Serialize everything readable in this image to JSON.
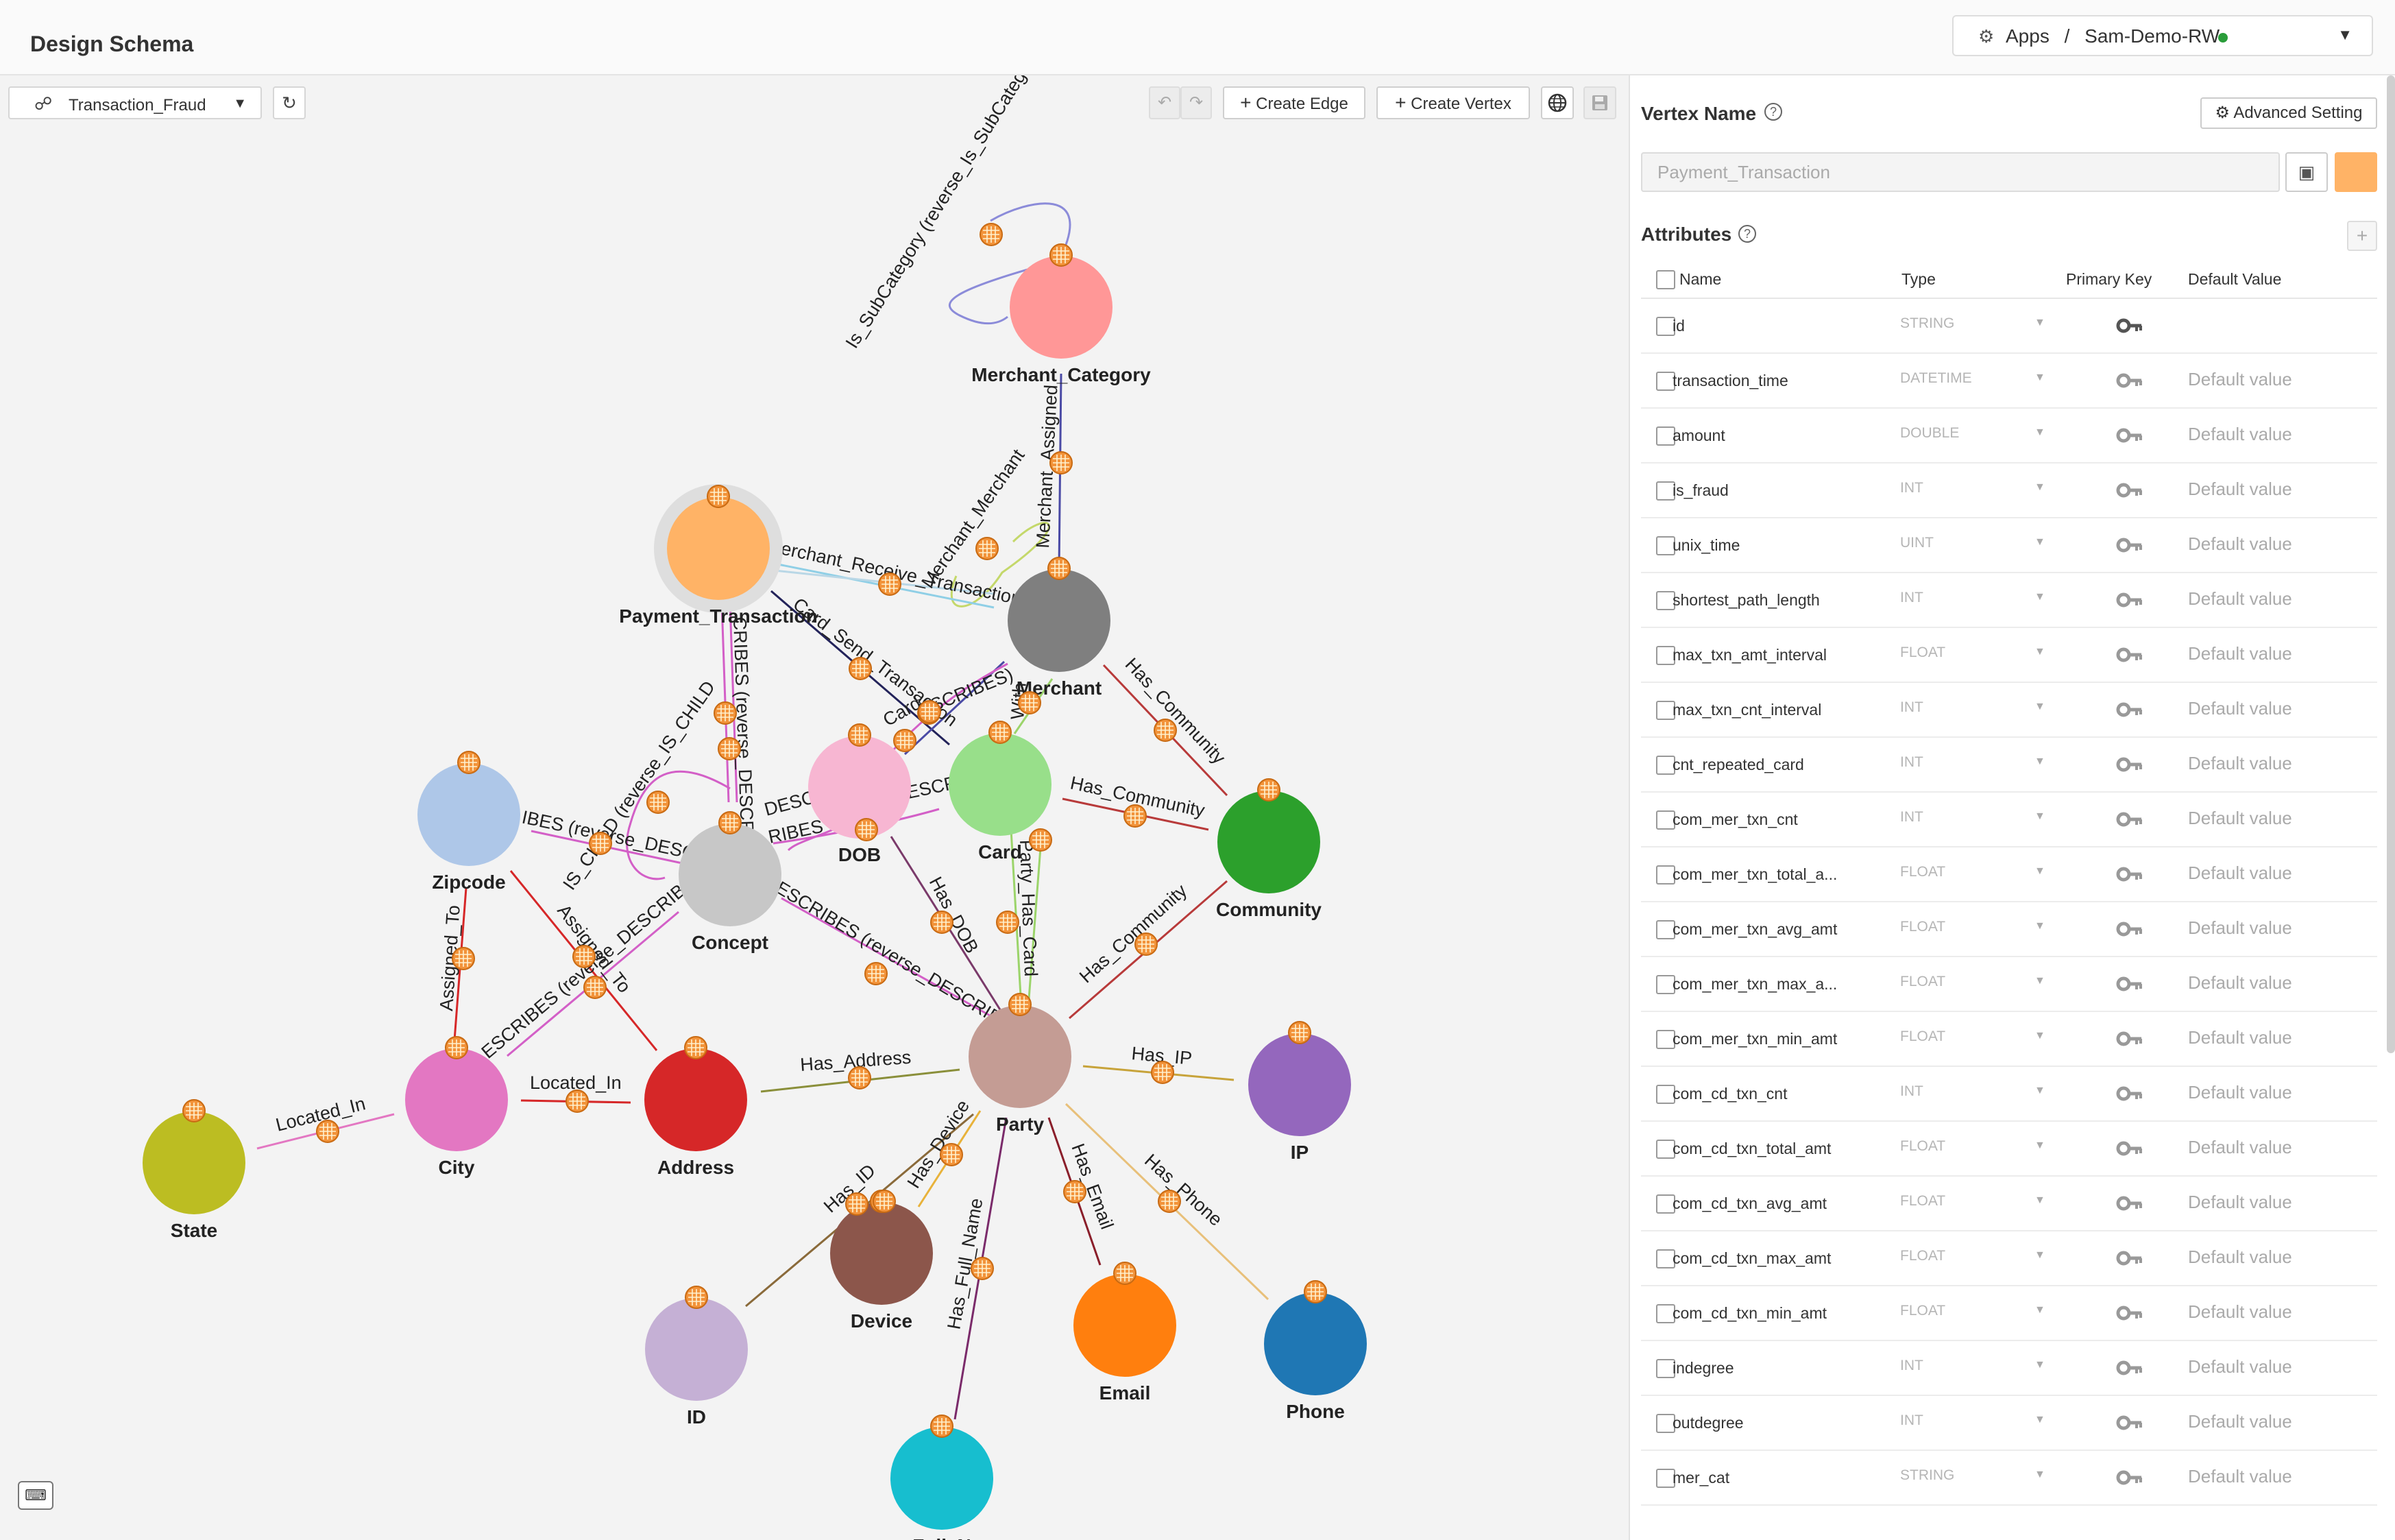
{
  "header": {
    "page_title": "Design Schema",
    "app_crumb": "Apps",
    "separator": "/",
    "workspace": "Sam-Demo-RW",
    "status_color": "#2a9d3a"
  },
  "toolbar": {
    "graph_name": "Transaction_Fraud",
    "create_edge_label": "Create Edge",
    "create_vertex_label": "Create Vertex"
  },
  "graph": {
    "vertices": [
      {
        "id": "merchant_category",
        "label": "Merchant_Category",
        "color": "#ff9797"
      },
      {
        "id": "payment_transaction",
        "label": "Payment_Transaction",
        "color": "#ffb366",
        "selected": true
      },
      {
        "id": "merchant",
        "label": "Merchant",
        "color": "#7f7f7f"
      },
      {
        "id": "zipcode",
        "label": "Zipcode",
        "color": "#aec7e8"
      },
      {
        "id": "concept",
        "label": "Concept",
        "color": "#c7c7c7"
      },
      {
        "id": "dob",
        "label": "DOB",
        "color": "#f7b6d2"
      },
      {
        "id": "card",
        "label": "Card",
        "color": "#98df8a"
      },
      {
        "id": "community",
        "label": "Community",
        "color": "#2ca02c"
      },
      {
        "id": "party",
        "label": "Party",
        "color": "#c49c94"
      },
      {
        "id": "ip",
        "label": "IP",
        "color": "#9467bd"
      },
      {
        "id": "city",
        "label": "City",
        "color": "#e377c2"
      },
      {
        "id": "address",
        "label": "Address",
        "color": "#d62728"
      },
      {
        "id": "state",
        "label": "State",
        "color": "#bcbd22"
      },
      {
        "id": "device",
        "label": "Device",
        "color": "#8c564b"
      },
      {
        "id": "id",
        "label": "ID",
        "color": "#c5b0d5"
      },
      {
        "id": "email",
        "label": "Email",
        "color": "#ff7f0e"
      },
      {
        "id": "phone",
        "label": "Phone",
        "color": "#1f77b4"
      },
      {
        "id": "full_name",
        "label": "Full_N",
        "color": "#17becf"
      }
    ],
    "edge_labels": [
      {
        "id": "is_subcategory",
        "label": "Is_SubCategory (reverse_Is_SubCategory)"
      },
      {
        "id": "merchant_assigned",
        "label": "Merchant_Assigned"
      },
      {
        "id": "merchant_merchant",
        "label": "Merchant_Merchant"
      },
      {
        "id": "merchant_receive",
        "label": "erchant_Receive_Transaction"
      },
      {
        "id": "card_send",
        "label": "Card_Send_Transaction"
      },
      {
        "id": "describes_pt",
        "label": "CRIBES (reverse_DESCRIB"
      },
      {
        "id": "has_community_merchant",
        "label": "Has_Community"
      },
      {
        "id": "has_community_card",
        "label": "Has_Community"
      },
      {
        "id": "has_community_party",
        "label": "Has_Community"
      },
      {
        "id": "describes_zip",
        "label": "IBES (reverse_DESC"
      },
      {
        "id": "is_child",
        "label": "IS_CHILD (reverse_IS_CHILD"
      },
      {
        "id": "describes_concept",
        "label": "ESCRIBES (reverse_DESCRIBE"
      },
      {
        "id": "has_dob",
        "label": "Has_DOB"
      },
      {
        "id": "party_has_card",
        "label": "Party_Has_Card"
      },
      {
        "id": "assigned_to_zip",
        "label": "Assigned_To"
      },
      {
        "id": "assigned_to_addr",
        "label": "Assigned_To"
      },
      {
        "id": "describes_city",
        "label": "ESCRIBES (reverse_DESCRIBE"
      },
      {
        "id": "has_address",
        "label": "Has_Address"
      },
      {
        "id": "has_ip",
        "label": "Has_IP"
      },
      {
        "id": "located_in_state",
        "label": "Located_In"
      },
      {
        "id": "located_in_addr",
        "label": "Located_In"
      },
      {
        "id": "has_device",
        "label": "Has_Device"
      },
      {
        "id": "has_id",
        "label": "Has_ID"
      },
      {
        "id": "has_full_name",
        "label": "Has_Full_Name"
      },
      {
        "id": "has_email",
        "label": "Has_Email"
      },
      {
        "id": "has_phone",
        "label": "Has_Phone"
      },
      {
        "id": "card_describes",
        "label": "ESCRIBES)"
      },
      {
        "id": "desc_dob",
        "label": "DESC"
      },
      {
        "id": "card_small",
        "label": "Card"
      },
      {
        "id": "merchant_with",
        "label": "With"
      },
      {
        "id": "dob_desc2",
        "label": "RIBES"
      },
      {
        "id": "card_desc3",
        "label": "ESCR"
      }
    ]
  },
  "panel": {
    "vertex_name_label": "Vertex Name",
    "advanced_label": "Advanced Setting",
    "vertex_name_value": "Payment_Transaction",
    "vertex_color": "#ffb366",
    "attributes_label": "Attributes",
    "columns": {
      "name": "Name",
      "type": "Type",
      "primary_key": "Primary Key",
      "default": "Default Value"
    },
    "attributes": [
      {
        "name": "id",
        "type": "STRING",
        "primary": true,
        "default": ""
      },
      {
        "name": "transaction_time",
        "type": "DATETIME",
        "primary": false,
        "default": "Default value"
      },
      {
        "name": "amount",
        "type": "DOUBLE",
        "primary": false,
        "default": "Default value"
      },
      {
        "name": "is_fraud",
        "type": "INT",
        "primary": false,
        "default": "Default value"
      },
      {
        "name": "unix_time",
        "type": "UINT",
        "primary": false,
        "default": "Default value"
      },
      {
        "name": "shortest_path_length",
        "type": "INT",
        "primary": false,
        "default": "Default value"
      },
      {
        "name": "max_txn_amt_interval",
        "type": "FLOAT",
        "primary": false,
        "default": "Default value"
      },
      {
        "name": "max_txn_cnt_interval",
        "type": "INT",
        "primary": false,
        "default": "Default value"
      },
      {
        "name": "cnt_repeated_card",
        "type": "INT",
        "primary": false,
        "default": "Default value"
      },
      {
        "name": "com_mer_txn_cnt",
        "type": "INT",
        "primary": false,
        "default": "Default value"
      },
      {
        "name": "com_mer_txn_total_a...",
        "type": "FLOAT",
        "primary": false,
        "default": "Default value"
      },
      {
        "name": "com_mer_txn_avg_amt",
        "type": "FLOAT",
        "primary": false,
        "default": "Default value"
      },
      {
        "name": "com_mer_txn_max_a...",
        "type": "FLOAT",
        "primary": false,
        "default": "Default value"
      },
      {
        "name": "com_mer_txn_min_amt",
        "type": "FLOAT",
        "primary": false,
        "default": "Default value"
      },
      {
        "name": "com_cd_txn_cnt",
        "type": "INT",
        "primary": false,
        "default": "Default value"
      },
      {
        "name": "com_cd_txn_total_amt",
        "type": "FLOAT",
        "primary": false,
        "default": "Default value"
      },
      {
        "name": "com_cd_txn_avg_amt",
        "type": "FLOAT",
        "primary": false,
        "default": "Default value"
      },
      {
        "name": "com_cd_txn_max_amt",
        "type": "FLOAT",
        "primary": false,
        "default": "Default value"
      },
      {
        "name": "com_cd_txn_min_amt",
        "type": "FLOAT",
        "primary": false,
        "default": "Default value"
      },
      {
        "name": "indegree",
        "type": "INT",
        "primary": false,
        "default": "Default value"
      },
      {
        "name": "outdegree",
        "type": "INT",
        "primary": false,
        "default": "Default value"
      },
      {
        "name": "mer_cat",
        "type": "STRING",
        "primary": false,
        "default": "Default value"
      }
    ]
  }
}
